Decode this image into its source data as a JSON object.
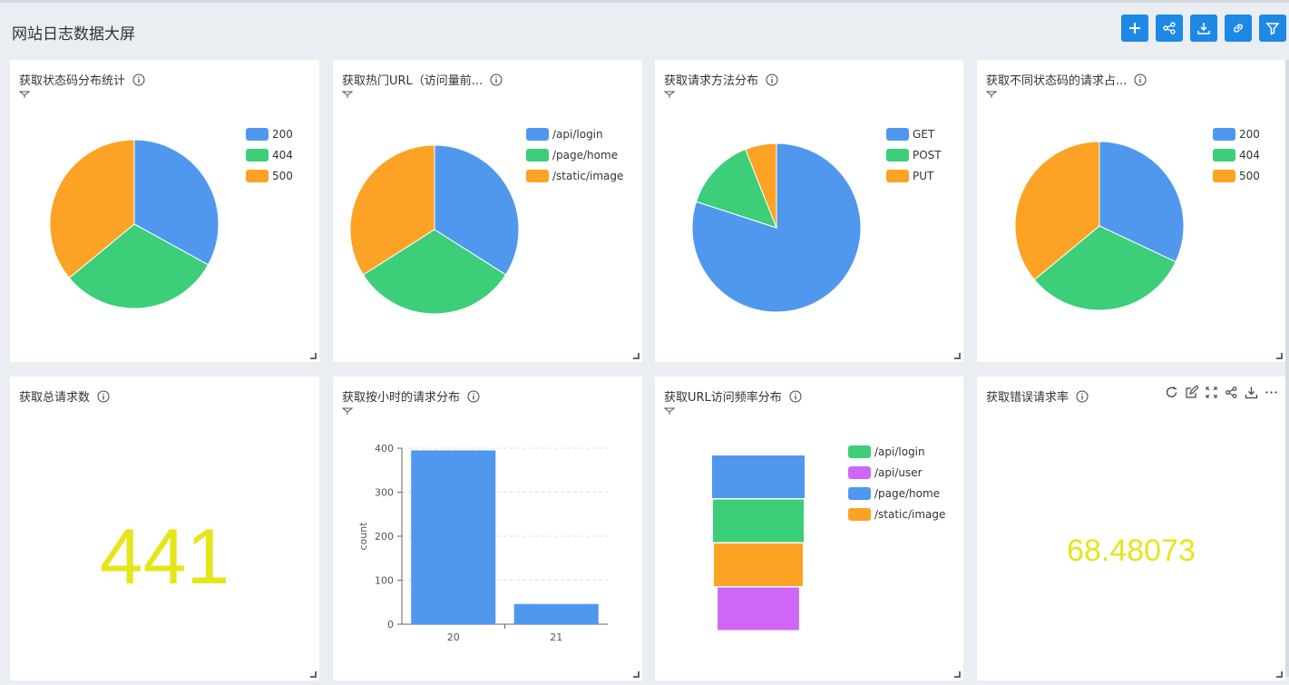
{
  "header": {
    "title": "网站日志数据大屏"
  },
  "toolbar": {
    "buttons": [
      "plus-icon",
      "share-icon",
      "download-icon",
      "link-icon",
      "filter-icon"
    ]
  },
  "colors": {
    "blue": "#5098ee",
    "green": "#3cce78",
    "orange": "#fca225",
    "purple": "#d066f5",
    "yellow": "#e6e51a",
    "accent": "#1e88e5"
  },
  "panels": [
    {
      "title": "获取状态码分布统计"
    },
    {
      "title": "获取热门URL（访问量前..."
    },
    {
      "title": "获取请求方法分布"
    },
    {
      "title": "获取不同状态码的请求占..."
    },
    {
      "title": "获取总请求数",
      "value": "441"
    },
    {
      "title": "获取按小时的请求分布"
    },
    {
      "title": "获取URL访问频率分布"
    },
    {
      "title": "获取错误请求率",
      "value": "68.48073"
    }
  ],
  "chart_data": [
    {
      "type": "pie",
      "labels": [
        "200",
        "404",
        "500"
      ],
      "values": [
        33,
        31,
        36
      ]
    },
    {
      "type": "pie",
      "labels": [
        "/api/login",
        "/page/home",
        "/static/image"
      ],
      "values": [
        34,
        32,
        34
      ]
    },
    {
      "type": "pie",
      "labels": [
        "GET",
        "POST",
        "PUT"
      ],
      "values": [
        80,
        14,
        6
      ]
    },
    {
      "type": "pie",
      "labels": [
        "200",
        "404",
        "500"
      ],
      "values": [
        32,
        32,
        36
      ]
    },
    {
      "type": "bar",
      "categories": [
        "20",
        "21"
      ],
      "values": [
        395,
        46
      ],
      "ylabel": "count",
      "ylim": [
        0,
        400
      ],
      "yticks": [
        0,
        100,
        200,
        300,
        400
      ],
      "grid": true
    },
    {
      "type": "funnel",
      "labels": [
        "/api/login",
        "/api/user",
        "/page/home",
        "/static/image"
      ],
      "series": [
        {
          "name": "/page/home",
          "value": 100,
          "color": "#5098ee"
        },
        {
          "name": "/api/login",
          "value": 98,
          "color": "#3cce78"
        },
        {
          "name": "/static/image",
          "value": 96,
          "color": "#fca225"
        },
        {
          "name": "/api/user",
          "value": 88,
          "color": "#d066f5"
        }
      ]
    }
  ]
}
